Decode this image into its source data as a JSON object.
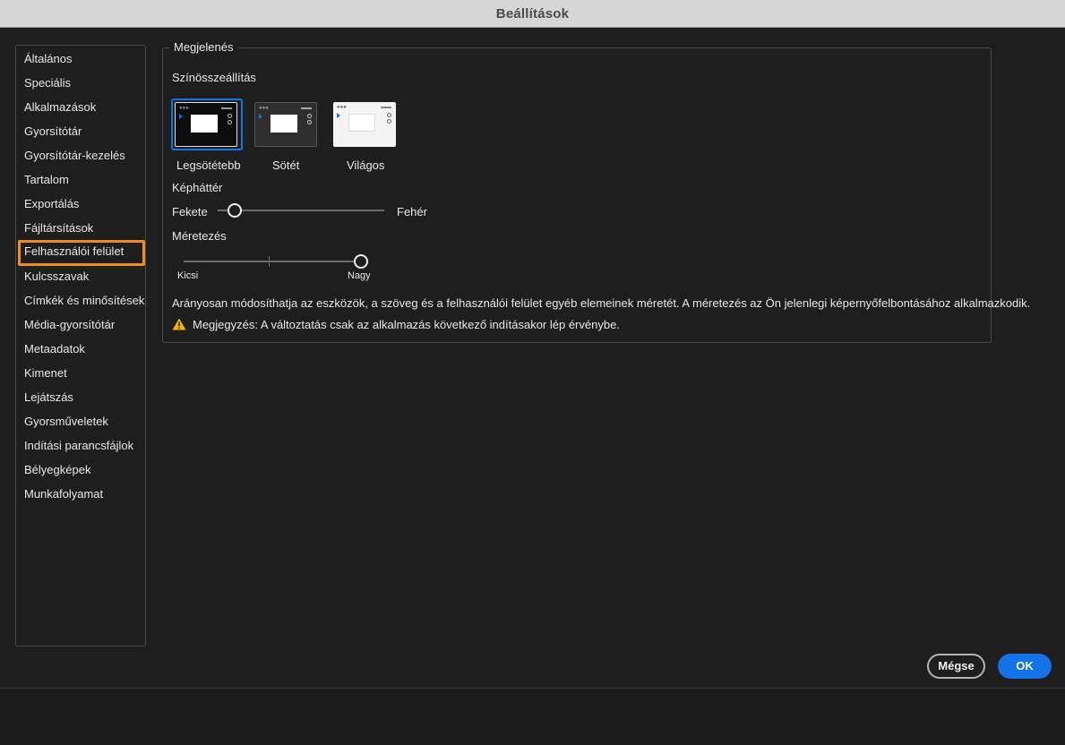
{
  "window": {
    "title": "Beállítások"
  },
  "sidebar": {
    "items": [
      {
        "label": "Általános"
      },
      {
        "label": "Speciális"
      },
      {
        "label": "Alkalmazások"
      },
      {
        "label": "Gyorsítótár"
      },
      {
        "label": "Gyorsítótár-kezelés"
      },
      {
        "label": "Tartalom"
      },
      {
        "label": "Exportálás"
      },
      {
        "label": "Fájltársítások"
      },
      {
        "label": "Felhasználói felület",
        "selected": true
      },
      {
        "label": "Kulcsszavak"
      },
      {
        "label": "Címkék és minősítések"
      },
      {
        "label": "Média-gyorsítótár"
      },
      {
        "label": "Metaadatok"
      },
      {
        "label": "Kimenet"
      },
      {
        "label": "Lejátszás"
      },
      {
        "label": "Gyorsműveletek"
      },
      {
        "label": "Indítási parancsfájlok"
      },
      {
        "label": "Bélyegképek"
      },
      {
        "label": "Munkafolyamat"
      }
    ],
    "selected_color": "#f28c1e"
  },
  "appearance": {
    "group_title": "Megjelenés",
    "color_scheme": {
      "label": "Színösszeállítás",
      "options": [
        {
          "label": "Legsötétebb",
          "selected": true
        },
        {
          "label": "Sötét",
          "selected": false
        },
        {
          "label": "Világos",
          "selected": false
        }
      ]
    },
    "image_background": {
      "label": "Képháttér",
      "min_label": "Fekete",
      "max_label": "Fehér",
      "value_fraction": 0.1
    },
    "scaling": {
      "label": "Méretezés",
      "min_label": "Kicsi",
      "max_label": "Nagy",
      "value_fraction": 1.0
    },
    "description": "Arányosan módosíthatja az eszközök, a szöveg és a felhasználói felület egyéb elemeinek méretét. A méretezés az Ön jelenlegi képernyőfelbontásához alkalmazkodik.",
    "note": "Megjegyzés: A változtatás csak az alkalmazás következő indításakor lép érvénybe.",
    "note_icon": "warning-icon",
    "warning_color": "#f5b400"
  },
  "footer": {
    "cancel_label": "Mégse",
    "ok_label": "OK",
    "accent_color": "#1473e6"
  }
}
